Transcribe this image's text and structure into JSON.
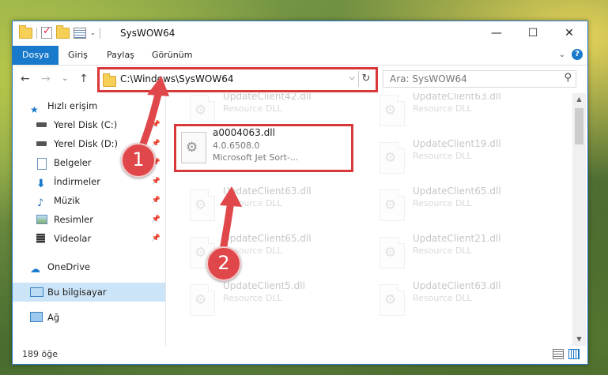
{
  "window": {
    "title": "SysWOW64",
    "minimize": "—",
    "maximize": "☐",
    "close": "✕"
  },
  "ribbon": {
    "tabs": [
      "Dosya",
      "Giriş",
      "Paylaş",
      "Görünüm"
    ],
    "active_tab": "Dosya",
    "collapse": "⌄",
    "help": "?"
  },
  "address": {
    "path": "C:\\Windows\\SysWOW64",
    "dropdown": "⌵",
    "refresh": "↻",
    "back": "←",
    "forward": "→",
    "recent": "⌄",
    "up": "↑"
  },
  "search": {
    "placeholder": "Ara: SysWOW64",
    "icon": "search-icon"
  },
  "sidebar": {
    "items": [
      {
        "label": "Hızlı erişim",
        "icon": "star-icon",
        "pinned": false
      },
      {
        "label": "Yerel Disk (C:)",
        "icon": "drive-icon",
        "pinned": true
      },
      {
        "label": "Yerel Disk (D:)",
        "icon": "drive-icon",
        "pinned": true
      },
      {
        "label": "Belgeler",
        "icon": "document-icon",
        "pinned": true
      },
      {
        "label": "İndirmeler",
        "icon": "download-icon",
        "pinned": true
      },
      {
        "label": "Müzik",
        "icon": "music-icon",
        "pinned": true
      },
      {
        "label": "Resimler",
        "icon": "picture-icon",
        "pinned": true
      },
      {
        "label": "Videolar",
        "icon": "video-icon",
        "pinned": true
      },
      {
        "label": "OneDrive",
        "icon": "cloud-icon",
        "pinned": false
      },
      {
        "label": "Bu bilgisayar",
        "icon": "computer-icon",
        "pinned": false
      },
      {
        "label": "Ağ",
        "icon": "network-icon",
        "pinned": false
      }
    ],
    "selected": "Bu bilgisayar",
    "pin_glyph": "📌"
  },
  "files": {
    "left": [
      {
        "name": "UpdateClient42.dll",
        "desc": "Resource DLL"
      },
      {
        "name": "UpdateClient63.dll",
        "desc": "Resource DLL"
      },
      {
        "name": "UpdateClient65.dll",
        "desc": "Resource DLL"
      },
      {
        "name": "UpdateClient5.dll",
        "desc": "Resource DLL"
      }
    ],
    "right": [
      {
        "name": "UpdateClient63.dll",
        "desc": "Resource DLL"
      },
      {
        "name": "UpdateClient19.dll",
        "desc": "Resource DLL"
      },
      {
        "name": "UpdateClient65.dll",
        "desc": "Resource DLL"
      },
      {
        "name": "UpdateClient21.dll",
        "desc": "Resource DLL"
      },
      {
        "name": "UpdateClient63.dll",
        "desc": "Resource DLL"
      }
    ],
    "highlighted": {
      "name": "a0004063.dll",
      "version": "4.0.6508.0",
      "desc": "Microsoft Jet Sort-..."
    }
  },
  "status": {
    "count": "189 öğe"
  },
  "badges": [
    "1",
    "2"
  ],
  "colors": {
    "accent": "#1979ca",
    "highlight": "#d9383a",
    "selection": "#cce4f7"
  }
}
